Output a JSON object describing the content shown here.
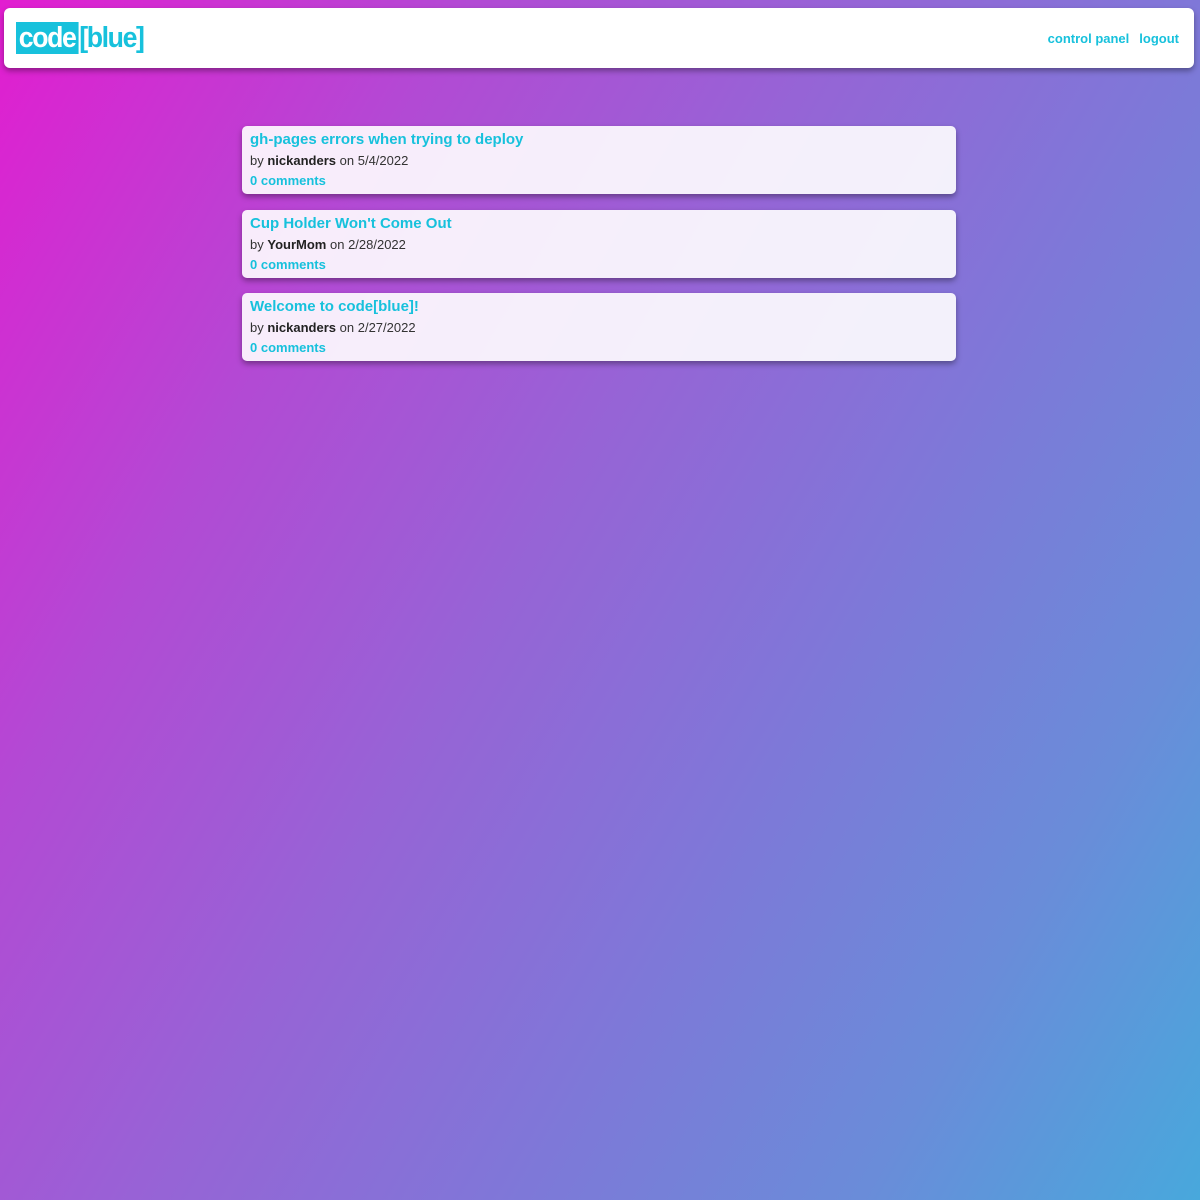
{
  "header": {
    "logo": {
      "part1": "code",
      "part2": "[blue]"
    },
    "nav": [
      {
        "label": "control panel"
      },
      {
        "label": "logout"
      }
    ]
  },
  "posts": [
    {
      "title": "gh-pages errors when trying to deploy",
      "by_label": "by",
      "author": "nickanders",
      "on_label": "on",
      "date": "5/4/2022",
      "comments": "0 comments"
    },
    {
      "title": "Cup Holder Won't Come Out",
      "by_label": "by",
      "author": "YourMom",
      "on_label": "on",
      "date": "2/28/2022",
      "comments": "0 comments"
    },
    {
      "title": "Welcome to code[blue]!",
      "by_label": "by",
      "author": "nickanders",
      "on_label": "on",
      "date": "2/27/2022",
      "comments": "0 comments"
    }
  ],
  "colors": {
    "accent": "#17c1dc",
    "gradient_start": "#e21dd0",
    "gradient_end": "#48a8dc"
  }
}
